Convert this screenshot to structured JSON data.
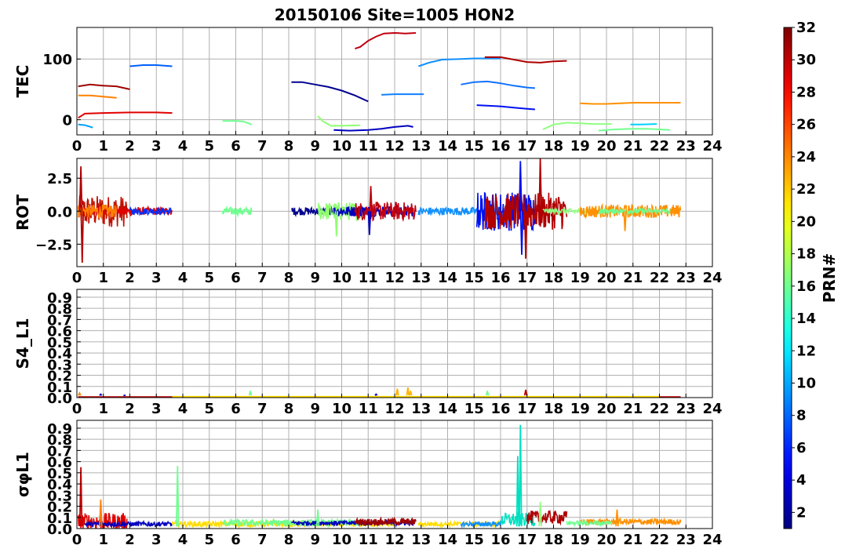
{
  "title": "20150106 Site=1005 HON2",
  "chart_data": [
    {
      "type": "line",
      "ylabel": "TEC",
      "xlim": [
        0,
        24
      ],
      "ylim": [
        -25,
        152
      ],
      "yticks": [
        0,
        100
      ],
      "ytick_labels": [
        "0",
        "100"
      ],
      "xticks": [
        0,
        1,
        2,
        3,
        4,
        5,
        6,
        7,
        8,
        9,
        10,
        11,
        12,
        13,
        14,
        15,
        16,
        17,
        18,
        19,
        20,
        21,
        22,
        23,
        24
      ],
      "grid": true,
      "series": [
        {
          "color": "#00a0ff",
          "points": [
            [
              0.05,
              -8
            ],
            [
              0.3,
              -9
            ],
            [
              0.6,
              -13
            ]
          ]
        },
        {
          "color": "#e00000",
          "points": [
            [
              0.05,
              3
            ],
            [
              0.3,
              10
            ],
            [
              1.0,
              11
            ],
            [
              2.0,
              12
            ],
            [
              3.0,
              12
            ],
            [
              3.6,
              11
            ]
          ]
        },
        {
          "color": "#ff8000",
          "points": [
            [
              0.05,
              40
            ],
            [
              0.5,
              40
            ],
            [
              1.0,
              38
            ],
            [
              1.5,
              36
            ]
          ]
        },
        {
          "color": "#a00000",
          "points": [
            [
              0.05,
              55
            ],
            [
              0.5,
              58
            ],
            [
              1.0,
              56
            ],
            [
              1.5,
              55
            ],
            [
              2.0,
              50
            ]
          ]
        },
        {
          "color": "#0060ff",
          "points": [
            [
              2.0,
              88
            ],
            [
              2.5,
              90
            ],
            [
              3.0,
              90
            ],
            [
              3.6,
              88
            ]
          ]
        },
        {
          "color": "#70ff90",
          "points": [
            [
              5.5,
              -2
            ],
            [
              6.0,
              -2
            ],
            [
              6.3,
              -3
            ],
            [
              6.6,
              -8
            ]
          ]
        },
        {
          "color": "#000090",
          "points": [
            [
              8.1,
              62
            ],
            [
              8.5,
              62
            ],
            [
              9.0,
              58
            ],
            [
              9.5,
              54
            ],
            [
              10.0,
              48
            ],
            [
              10.5,
              40
            ],
            [
              11.0,
              30
            ]
          ]
        },
        {
          "color": "#90ff70",
          "points": [
            [
              9.1,
              6
            ],
            [
              9.3,
              -3
            ],
            [
              9.6,
              -10
            ],
            [
              10.0,
              -10
            ],
            [
              10.7,
              -9
            ]
          ]
        },
        {
          "color": "#0000c0",
          "points": [
            [
              9.7,
              -17
            ],
            [
              10.3,
              -18
            ],
            [
              11.0,
              -17
            ],
            [
              11.5,
              -15
            ],
            [
              12.0,
              -12
            ],
            [
              12.5,
              -10
            ],
            [
              12.7,
              -12
            ]
          ]
        },
        {
          "color": "#c00010",
          "points": [
            [
              10.5,
              117
            ],
            [
              10.7,
              120
            ],
            [
              11.0,
              130
            ],
            [
              11.3,
              137
            ],
            [
              11.6,
              142
            ],
            [
              12.0,
              143
            ],
            [
              12.4,
              142
            ],
            [
              12.8,
              143
            ]
          ]
        },
        {
          "color": "#1080ff",
          "points": [
            [
              11.5,
              41
            ],
            [
              12.0,
              42
            ],
            [
              12.5,
              42
            ],
            [
              13.1,
              42
            ]
          ]
        },
        {
          "color": "#1090ff",
          "points": [
            [
              12.9,
              88
            ],
            [
              13.3,
              94
            ],
            [
              13.8,
              99
            ],
            [
              14.5,
              100
            ],
            [
              15.0,
              101
            ],
            [
              15.5,
              101
            ],
            [
              16.0,
              101
            ]
          ]
        },
        {
          "color": "#1070ff",
          "points": [
            [
              14.5,
              58
            ],
            [
              15.0,
              62
            ],
            [
              15.5,
              63
            ],
            [
              16.0,
              60
            ],
            [
              16.5,
              56
            ],
            [
              17.0,
              53
            ],
            [
              17.3,
              52
            ]
          ]
        },
        {
          "color": "#0010f0",
          "points": [
            [
              15.1,
              24
            ],
            [
              15.5,
              23
            ],
            [
              16.0,
              22
            ],
            [
              16.5,
              20
            ],
            [
              17.0,
              18
            ],
            [
              17.3,
              17
            ]
          ]
        },
        {
          "color": "#b00000",
          "points": [
            [
              15.4,
              103
            ],
            [
              16.0,
              103
            ],
            [
              16.5,
              99
            ],
            [
              17.0,
              95
            ],
            [
              17.5,
              94
            ],
            [
              18.0,
              96
            ],
            [
              18.5,
              97
            ]
          ]
        },
        {
          "color": "#90ff80",
          "points": [
            [
              17.6,
              -16
            ],
            [
              18.0,
              -8
            ],
            [
              18.5,
              -5
            ],
            [
              19.0,
              -6
            ],
            [
              19.5,
              -7
            ],
            [
              20.2,
              -7
            ]
          ]
        },
        {
          "color": "#ff9000",
          "points": [
            [
              19.0,
              27
            ],
            [
              19.5,
              26
            ],
            [
              20.0,
              26
            ],
            [
              20.5,
              27
            ],
            [
              21.0,
              28
            ],
            [
              21.5,
              28
            ],
            [
              22.0,
              28
            ],
            [
              22.8,
              28
            ]
          ]
        },
        {
          "color": "#70ff90",
          "points": [
            [
              19.7,
              -18
            ],
            [
              20.3,
              -16
            ],
            [
              21.0,
              -15
            ],
            [
              21.5,
              -15
            ],
            [
              22.0,
              -16
            ],
            [
              22.4,
              -17
            ]
          ]
        },
        {
          "color": "#00d0ff",
          "points": [
            [
              20.9,
              -8
            ],
            [
              21.3,
              -8
            ],
            [
              21.9,
              -7
            ]
          ]
        }
      ]
    },
    {
      "type": "line",
      "ylabel": "ROT",
      "xlim": [
        0,
        24
      ],
      "ylim": [
        -4.2,
        4.0
      ],
      "yticks": [
        -2.5,
        0.0,
        2.5
      ],
      "ytick_labels": [
        "−2.5",
        "0.0",
        "2.5"
      ],
      "xticks": [
        0,
        1,
        2,
        3,
        4,
        5,
        6,
        7,
        8,
        9,
        10,
        11,
        12,
        13,
        14,
        15,
        16,
        17,
        18,
        19,
        20,
        21,
        22,
        23,
        24
      ],
      "grid": true,
      "noise_segments": [
        {
          "color": "#c01000",
          "x0": 0.05,
          "x1": 1.9,
          "amp": 1.2
        },
        {
          "color": "#e00000",
          "x0": 0.05,
          "x1": 3.6,
          "amp": 0.3
        },
        {
          "color": "#ff8000",
          "x0": 0.05,
          "x1": 1.5,
          "amp": 0.5
        },
        {
          "color": "#0030ff",
          "x0": 2.0,
          "x1": 3.6,
          "amp": 0.25
        },
        {
          "color": "#70ff90",
          "x0": 5.5,
          "x1": 6.6,
          "amp": 0.3
        },
        {
          "color": "#000090",
          "x0": 8.1,
          "x1": 11.0,
          "amp": 0.3
        },
        {
          "color": "#90ff70",
          "x0": 9.1,
          "x1": 10.7,
          "amp": 0.7
        },
        {
          "color": "#0000c0",
          "x0": 9.7,
          "x1": 12.7,
          "amp": 0.4
        },
        {
          "color": "#c00010",
          "x0": 10.5,
          "x1": 12.8,
          "amp": 0.7
        },
        {
          "color": "#1090ff",
          "x0": 12.9,
          "x1": 16.0,
          "amp": 0.3
        },
        {
          "color": "#0010f0",
          "x0": 15.1,
          "x1": 17.3,
          "amp": 1.5
        },
        {
          "color": "#b00000",
          "x0": 15.4,
          "x1": 18.5,
          "amp": 1.4
        },
        {
          "color": "#90ff80",
          "x0": 17.6,
          "x1": 20.2,
          "amp": 0.2
        },
        {
          "color": "#ff9000",
          "x0": 19.0,
          "x1": 22.8,
          "amp": 0.5
        },
        {
          "color": "#70ff90",
          "x0": 19.7,
          "x1": 22.4,
          "amp": 0.2
        }
      ],
      "spikes": [
        {
          "color": "#b00000",
          "x": 0.15,
          "y": 3.4
        },
        {
          "color": "#b00000",
          "x": 0.2,
          "y": -3.9
        },
        {
          "color": "#90ff70",
          "x": 9.8,
          "y": -1.9
        },
        {
          "color": "#0000c0",
          "x": 11.05,
          "y": -1.8
        },
        {
          "color": "#c00010",
          "x": 11.1,
          "y": 1.9
        },
        {
          "color": "#0010f0",
          "x": 16.75,
          "y": 3.8
        },
        {
          "color": "#0010f0",
          "x": 16.8,
          "y": -3.3
        },
        {
          "color": "#b00000",
          "x": 16.95,
          "y": -3.6
        },
        {
          "color": "#b00000",
          "x": 17.5,
          "y": 4.0
        },
        {
          "color": "#ff9000",
          "x": 20.7,
          "y": -1.5
        }
      ]
    },
    {
      "type": "line",
      "ylabel": "S4_L1",
      "xlim": [
        0,
        24
      ],
      "ylim": [
        0.0,
        0.97
      ],
      "yticks": [
        0.0,
        0.1,
        0.2,
        0.3,
        0.4,
        0.5,
        0.6,
        0.7,
        0.8,
        0.9
      ],
      "ytick_labels": [
        "0.0",
        "0.1",
        "0.2",
        "0.3",
        "0.4",
        "0.5",
        "0.6",
        "0.7",
        "0.8",
        "0.9"
      ],
      "xticks": [
        0,
        1,
        2,
        3,
        4,
        5,
        6,
        7,
        8,
        9,
        10,
        11,
        12,
        13,
        14,
        15,
        16,
        17,
        18,
        19,
        20,
        21,
        22,
        23,
        24
      ],
      "grid": true,
      "baseline_segments": [
        {
          "color": "#c00000",
          "x0": 0.05,
          "x1": 22.8,
          "level": 0.005
        },
        {
          "color": "#ffdd00",
          "x0": 3.6,
          "x1": 22.0,
          "level": 0.008
        }
      ],
      "spikes": [
        {
          "color": "#ff8000",
          "x": 0.1,
          "y": 0.04
        },
        {
          "color": "#0000c0",
          "x": 0.9,
          "y": 0.03
        },
        {
          "color": "#0000c0",
          "x": 1.8,
          "y": 0.02
        },
        {
          "color": "#70ff90",
          "x": 6.55,
          "y": 0.06
        },
        {
          "color": "#0000c0",
          "x": 11.3,
          "y": 0.03
        },
        {
          "color": "#ffb000",
          "x": 12.1,
          "y": 0.08
        },
        {
          "color": "#ffb000",
          "x": 12.5,
          "y": 0.09
        },
        {
          "color": "#ffb000",
          "x": 12.6,
          "y": 0.06
        },
        {
          "color": "#70ff90",
          "x": 15.5,
          "y": 0.06
        },
        {
          "color": "#c00000",
          "x": 16.95,
          "y": 0.07
        }
      ]
    },
    {
      "type": "line",
      "ylabel": "σφL1",
      "xlim": [
        0,
        24
      ],
      "ylim": [
        0.0,
        0.97
      ],
      "yticks": [
        0.0,
        0.1,
        0.2,
        0.3,
        0.4,
        0.5,
        0.6,
        0.7,
        0.8,
        0.9
      ],
      "ytick_labels": [
        "0.0",
        "0.1",
        "0.2",
        "0.3",
        "0.4",
        "0.5",
        "0.6",
        "0.7",
        "0.8",
        "0.9"
      ],
      "xticks": [
        0,
        1,
        2,
        3,
        4,
        5,
        6,
        7,
        8,
        9,
        10,
        11,
        12,
        13,
        14,
        15,
        16,
        17,
        18,
        19,
        20,
        21,
        22,
        23,
        24
      ],
      "grid": true,
      "noise_segments": [
        {
          "color": "#e00000",
          "x0": 0.05,
          "x1": 1.9,
          "base": 0.06,
          "amp": 0.08
        },
        {
          "color": "#0000c0",
          "x0": 0.3,
          "x1": 3.6,
          "base": 0.04,
          "amp": 0.02
        },
        {
          "color": "#ffdd00",
          "x0": 3.6,
          "x1": 12.0,
          "base": 0.04,
          "amp": 0.025
        },
        {
          "color": "#70ff90",
          "x0": 5.5,
          "x1": 10.7,
          "base": 0.05,
          "amp": 0.03
        },
        {
          "color": "#0000c0",
          "x0": 8.1,
          "x1": 12.7,
          "base": 0.05,
          "amp": 0.02
        },
        {
          "color": "#a00000",
          "x0": 10.5,
          "x1": 12.8,
          "base": 0.06,
          "amp": 0.03
        },
        {
          "color": "#ffdd00",
          "x0": 12.9,
          "x1": 16.0,
          "base": 0.04,
          "amp": 0.02
        },
        {
          "color": "#1090ff",
          "x0": 14.5,
          "x1": 16.0,
          "base": 0.04,
          "amp": 0.02
        },
        {
          "color": "#00e0c0",
          "x0": 16.0,
          "x1": 17.3,
          "base": 0.08,
          "amp": 0.06
        },
        {
          "color": "#b00000",
          "x0": 17.0,
          "x1": 18.5,
          "base": 0.1,
          "amp": 0.06
        },
        {
          "color": "#ff9000",
          "x0": 19.0,
          "x1": 22.8,
          "base": 0.06,
          "amp": 0.025
        },
        {
          "color": "#70ff90",
          "x0": 18.5,
          "x1": 20.2,
          "base": 0.05,
          "amp": 0.02
        }
      ],
      "spikes": [
        {
          "color": "#c00000",
          "x": 0.15,
          "y": 0.55
        },
        {
          "color": "#ff8000",
          "x": 0.9,
          "y": 0.26
        },
        {
          "color": "#70ff90",
          "x": 3.8,
          "y": 0.56
        },
        {
          "color": "#00e0c0",
          "x": 16.75,
          "y": 0.93
        },
        {
          "color": "#00e0c0",
          "x": 16.65,
          "y": 0.65
        },
        {
          "color": "#90ff80",
          "x": 17.5,
          "y": 0.24
        },
        {
          "color": "#70ff90",
          "x": 9.1,
          "y": 0.17
        },
        {
          "color": "#ff9000",
          "x": 20.4,
          "y": 0.17
        }
      ]
    }
  ],
  "colorbar": {
    "label": "PRN#",
    "min": 1,
    "max": 32,
    "ticks": [
      2,
      4,
      6,
      8,
      10,
      12,
      14,
      16,
      18,
      20,
      22,
      24,
      26,
      28,
      30,
      32
    ],
    "colormap": "jet"
  }
}
